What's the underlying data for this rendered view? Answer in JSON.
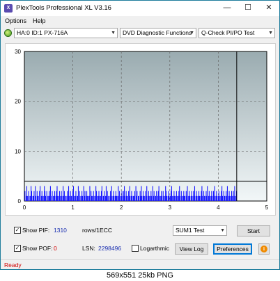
{
  "window": {
    "title": "PlexTools Professional XL V3.16",
    "app_icon_text": "X",
    "minimize_glyph": "—",
    "maximize_glyph": "☐",
    "close_glyph": "✕"
  },
  "menu": {
    "options": "Options",
    "help": "Help"
  },
  "toolbar": {
    "drive": "HA:0 ID:1  PX-716A",
    "function": "DVD Diagnostic Functions",
    "test": "Q-Check PI/PO Test",
    "dropdown_glyph": "▼"
  },
  "chart_data": {
    "type": "bar",
    "x_ticks": [
      "0",
      "1",
      "2",
      "3",
      "4",
      "5"
    ],
    "y_ticks": [
      "0",
      "10",
      "20",
      "30"
    ],
    "xlim": [
      0,
      5
    ],
    "ylim": [
      0,
      30
    ],
    "threshold": 4,
    "end_marker_x": 4.38,
    "grid": true,
    "background_gradient": [
      "#9aabb0",
      "#f2f7f8"
    ],
    "bar_color": "#1a1aff",
    "bar_x_step": 0.0125,
    "bar_values": [
      2,
      0,
      1,
      3,
      1,
      0,
      2,
      1,
      0,
      1,
      3,
      2,
      0,
      1,
      1,
      2,
      0,
      3,
      1,
      0,
      2,
      1,
      1,
      0,
      2,
      3,
      0,
      1,
      2,
      1,
      0,
      1,
      3,
      2,
      1,
      0,
      2,
      1,
      0,
      1,
      2,
      1,
      3,
      0,
      1,
      2,
      0,
      1,
      1,
      2,
      0,
      1,
      2,
      3,
      1,
      0,
      1,
      2,
      1,
      0,
      2,
      1,
      0,
      3,
      1,
      2,
      0,
      1,
      1,
      0,
      2,
      1,
      3,
      1,
      0,
      2,
      1,
      1,
      0,
      2,
      3,
      1,
      0,
      1,
      2,
      0,
      1,
      1,
      3,
      0,
      2,
      1,
      0,
      1,
      2,
      1,
      0,
      3,
      1,
      2,
      0,
      1,
      2,
      1,
      0,
      1,
      1,
      3,
      0,
      2,
      1,
      1,
      0,
      2,
      1,
      0,
      1,
      3,
      2,
      1,
      0,
      1,
      2,
      1,
      0,
      1,
      2,
      3,
      0,
      1,
      1,
      2,
      0,
      1,
      3,
      1,
      2,
      0,
      1,
      1,
      0,
      2,
      1,
      3,
      0,
      1,
      2,
      1,
      0,
      1,
      2,
      1,
      1,
      0,
      3,
      1,
      2,
      0,
      1,
      1,
      2,
      0,
      1,
      2,
      3,
      1,
      0,
      2,
      1,
      1,
      0,
      2,
      1,
      3,
      0,
      1,
      2,
      1,
      0,
      1,
      1,
      2,
      0,
      3,
      1,
      2,
      0,
      1,
      1,
      0,
      2,
      1,
      3,
      1,
      0,
      2,
      1,
      1,
      0,
      2,
      1,
      3,
      0,
      1,
      2,
      1,
      0,
      1,
      2,
      1,
      0,
      3,
      1,
      2,
      0,
      1,
      1,
      2,
      0,
      1,
      2,
      3,
      1,
      0,
      1,
      2,
      1,
      0,
      2,
      1,
      0,
      1,
      3,
      2,
      1,
      0,
      1,
      2,
      1,
      0,
      1,
      2,
      3,
      1,
      0,
      1,
      2,
      1,
      0,
      1,
      2,
      1,
      0,
      1,
      2,
      3,
      1,
      0,
      2,
      1,
      0,
      1,
      2,
      1,
      1,
      0,
      2,
      1,
      3,
      0,
      1,
      2,
      1,
      0,
      1,
      2,
      1,
      0,
      2,
      1,
      3,
      0,
      1,
      2,
      1,
      0,
      1,
      2,
      1,
      0,
      1,
      2,
      3,
      1,
      0,
      2,
      1,
      1,
      0,
      2,
      1,
      3,
      0,
      1,
      2,
      1,
      0,
      1,
      2,
      1,
      0,
      2,
      1,
      3,
      0,
      1,
      2,
      1,
      0,
      1,
      2,
      1,
      0,
      1,
      2,
      3,
      1,
      0,
      2,
      1,
      1,
      0,
      2,
      1,
      3,
      0,
      1,
      2,
      1,
      0,
      1,
      2,
      1,
      0,
      2,
      1,
      3,
      0,
      1,
      2,
      1,
      0,
      1,
      2,
      3,
      1,
      0,
      2,
      1,
      1,
      0,
      2,
      1,
      3,
      0,
      1,
      2,
      1,
      0,
      1,
      2,
      1,
      0,
      2,
      1,
      3,
      0,
      1,
      2,
      1,
      0,
      1,
      2,
      1,
      0,
      1,
      2,
      3,
      1,
      0,
      2,
      1,
      1,
      0,
      2,
      1,
      3,
      0,
      1,
      2,
      1,
      0,
      1
    ]
  },
  "panel": {
    "show_pif_label": "Show PIF:",
    "pif_value": "1310",
    "rows_label": "rows/1ECC",
    "show_pof_label": "Show POF:",
    "pof_value": "0",
    "lsn_label": "LSN:",
    "lsn_value": "2298496",
    "logarithmic_label": "Logarthmic",
    "sum_combo": "SUM1 Test",
    "start_button": "Start",
    "view_log_button": "View Log",
    "preferences_button": "Preferences",
    "info_glyph": "i",
    "check_glyph": "✓"
  },
  "status": {
    "text": "Ready"
  },
  "caption": {
    "text": "569x551  25kb  PNG"
  }
}
